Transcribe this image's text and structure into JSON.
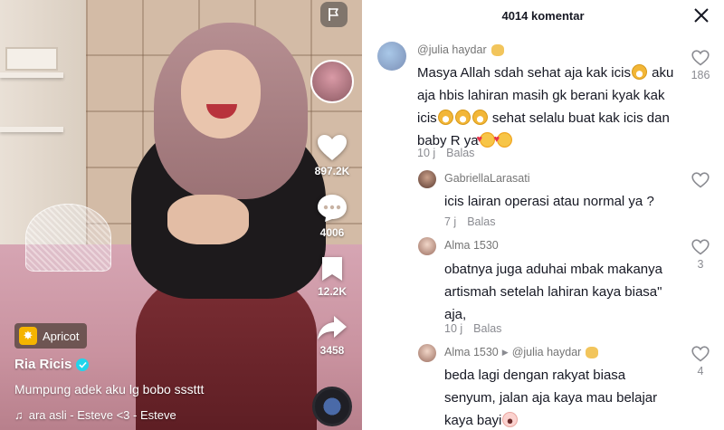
{
  "video": {
    "app_badge": "Apricot",
    "username": "Ria Ricis",
    "caption": "Mumpung adek aku lg bobo sssttt",
    "sound": "ara asli - Esteve <3 - Esteve",
    "actions": {
      "likes": "897.2K",
      "comments": "4006",
      "saves": "12.2K",
      "shares": "3458"
    }
  },
  "panel": {
    "title": "4014 komentar"
  },
  "comments": [
    {
      "user": "@julia haydar",
      "lines": [
        "Masya Allah sdah sehat aja kak icis",
        "aja hbis lahiran masih gk berani kyak kak",
        "icis",
        "baby R ya"
      ],
      "line_parts": {
        "l1_a": "Masya Allah sdah sehat aja kak icis",
        "l1_b": " aku",
        "l2": "aja hbis lahiran masih gk berani kyak kak",
        "l3_a": "icis",
        "l3_b": " sehat selalu buat kak icis dan",
        "l4": "baby R ya"
      },
      "time": "10 j",
      "reply_label": "Balas",
      "likes": "186"
    },
    {
      "user": "GabriellaLarasati",
      "text": "icis lairan operasi atau normal ya ?",
      "time": "7 j",
      "reply_label": "Balas",
      "likes": ""
    },
    {
      "user": "Alma 1530",
      "line1": "obatnya juga aduhai mbak makanya",
      "line2": "artismah setelah lahiran kaya biasa\"",
      "line3": "aja,",
      "time": "10 j",
      "reply_label": "Balas",
      "likes": "3"
    },
    {
      "user": "Alma 1530",
      "reply_to": "@julia haydar",
      "line1": "beda lagi dengan rakyat biasa",
      "line2": "senyum, jalan aja kaya mau belajar",
      "line3": "kaya bayi",
      "likes": "4"
    }
  ],
  "icons": {
    "flag": "flag-icon",
    "heart": "heart-icon",
    "comment": "comment-icon",
    "bookmark": "bookmark-icon",
    "share": "share-icon",
    "music": "music-note-icon",
    "close": "close-icon"
  },
  "colors": {
    "verified": "#20d5ec",
    "apricot_badge": "#f5b400",
    "muted_text": "#8a8b91"
  }
}
